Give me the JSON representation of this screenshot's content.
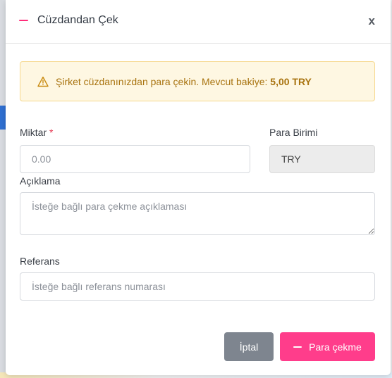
{
  "modal": {
    "title": "Cüzdandan Çek",
    "close_label": "x",
    "accent_color": "#ff3d8b"
  },
  "alert": {
    "text": "Şirket cüzdanınızdan para çekin. Mevcut bakiye: ",
    "balance": "5,00 TRY",
    "icon": "warning-icon"
  },
  "form": {
    "amount_label": "Miktar",
    "amount_required_mark": "*",
    "amount_placeholder": "0.00",
    "currency_label": "Para Birimi",
    "currency_value": "TRY",
    "description_label": "Açıklama",
    "description_placeholder": "İsteğe bağlı para çekme açıklaması",
    "reference_label": "Referans",
    "reference_placeholder": "İsteğe bağlı referans numarası"
  },
  "buttons": {
    "cancel_label": "İptal",
    "submit_label": "Para çekme",
    "submit_icon": "minus-icon"
  }
}
